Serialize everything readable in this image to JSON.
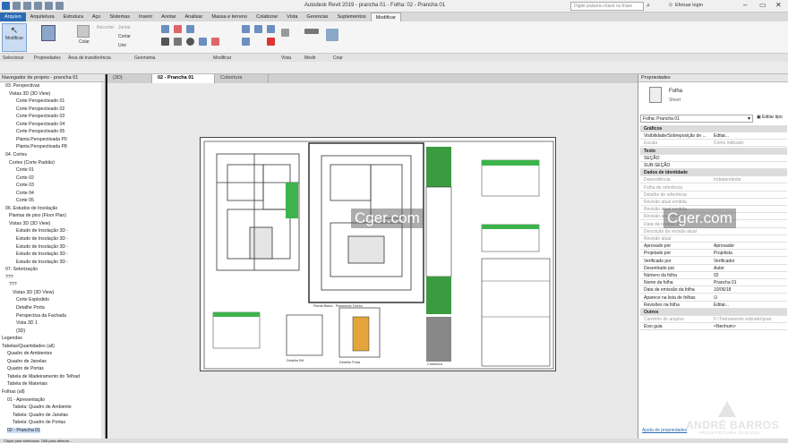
{
  "window": {
    "title": "Autodesk Revit 2019 - prancha 01 - Folha: 02 - Prancha 01",
    "search_placeholder": "Digite palavra-chave ou frase",
    "user": "Efetuar login"
  },
  "tabs": [
    "Arquivo",
    "Arquitetura",
    "Estrutura",
    "Aço",
    "Sistemas",
    "Inserir",
    "Anotar",
    "Analisar",
    "Massa e terreno",
    "Colaborar",
    "Vista",
    "Gerenciar",
    "Suplementos",
    "Modificar"
  ],
  "active_tab": "Modificar",
  "ribbon": {
    "modify_button": "Modificar",
    "buttons": [
      "Colar",
      "Recortar",
      "Cortar",
      "Unir",
      "Juntar"
    ],
    "panels": [
      "Selecionar",
      "Propriedades",
      "Área de transferência",
      "Geometria",
      "Modificar",
      "Vista",
      "Medir",
      "Criar"
    ]
  },
  "view_tabs": [
    "{3D}",
    "02 - Prancha 01",
    "Cobertura"
  ],
  "browser": {
    "title": "Navegador de projeto - prancha 01",
    "items": [
      "03. Perspectivas",
      "Vistas 3D (3D View)",
      "Corte Perspectivado 01",
      "Corte Perspectivado 02",
      "Corte Perspectivado 03",
      "Corte Perspectivado 04",
      "Corte Perspectivado 05",
      "Planta Perspectivada P0",
      "Planta Perspectivada P8",
      "04. Cortes",
      "Cortes (Corte Padrão)",
      "Corte 01",
      "Corte 02",
      "Corte 03",
      "Corte 04",
      "Corte 05",
      "06. Estudos de Insolação",
      "Plantas de piso (Floor Plan)",
      "Vistas 3D (3D View)",
      "Estudo de Insolação 3D -",
      "Estudo de Insolação 3D -",
      "Estudo de Insolação 3D -",
      "Estudo de Insolação 3D -",
      "Estudo de Insolação 3D -",
      "07. Setorização",
      "???",
      "???",
      "Vistas 3D (3D View)",
      "Corte Explodido",
      "Detalhe Porta",
      "Perspectiva da Fachada",
      "Vista 3D 1",
      "{3D}",
      "Legendas",
      "Tabelas/Quantidades (all)",
      "Quadro de Ambientes",
      "Quadro de Janelas",
      "Quadro de Portas",
      "Tabela de Madeiramento do Telhad",
      "Tabela de Materiais",
      "Folhas (all)",
      "01 - Apresentação",
      "Tabela: Quadro de Ambiente",
      "Tabela: Quadro de Janelas",
      "Tabela: Quadro de Portas",
      "02 - Prancha 01"
    ]
  },
  "sheet": {
    "labels": [
      "Planta Baixa - Pavimento Térreo",
      "Detalhe BH",
      "Detalhe Porta",
      "Cobertura"
    ],
    "watermark": "Cger.com"
  },
  "properties": {
    "title": "Propriedades",
    "type_name": "Folha",
    "type_sub": "Sheet",
    "selector": "Folha: Prancha 01",
    "edit_type": "Editar tipo",
    "rows": [
      {
        "k": "Gráficos",
        "v": "",
        "sec": true
      },
      {
        "k": "Visibilidade/Sobreposição de ...",
        "v": "Editar..."
      },
      {
        "k": "Escala",
        "v": "Como indicado",
        "dim": true
      },
      {
        "k": "Texto",
        "v": "",
        "sec": true
      },
      {
        "k": "SEÇÃO",
        "v": ""
      },
      {
        "k": "SUB-SEÇÃO",
        "v": ""
      },
      {
        "k": "Dados de identidade",
        "v": "",
        "sec": true
      },
      {
        "k": "Dependência",
        "v": "Independente",
        "dim": true
      },
      {
        "k": "Folha de referência",
        "v": "",
        "dim": true
      },
      {
        "k": "Detalhe de referência",
        "v": "",
        "dim": true
      },
      {
        "k": "Revisão atual emitida",
        "v": "",
        "dim": true
      },
      {
        "k": "Revisão atual emitida",
        "v": "",
        "dim": true
      },
      {
        "k": "Revisão atual emitida",
        "v": "",
        "dim": true
      },
      {
        "k": "Data da revisão atual",
        "v": "",
        "dim": true
      },
      {
        "k": "Descrição da revisão atual",
        "v": "",
        "dim": true
      },
      {
        "k": "Revisão atual",
        "v": "",
        "dim": true
      },
      {
        "k": "Aprovado por",
        "v": "Aprovador"
      },
      {
        "k": "Projetado por",
        "v": "Projetista"
      },
      {
        "k": "Verificado por",
        "v": "Verificador"
      },
      {
        "k": "Desenhado por",
        "v": "Autor"
      },
      {
        "k": "Número da folha",
        "v": "02"
      },
      {
        "k": "Nome da folha",
        "v": "Prancha 01"
      },
      {
        "k": "Data de emissão da folha",
        "v": "10/06/18"
      },
      {
        "k": "Aparece na lista de folhas",
        "v": "☑"
      },
      {
        "k": "Revisões na folha",
        "v": "Editar..."
      },
      {
        "k": "Outros",
        "v": "",
        "sec": true
      },
      {
        "k": "Caminho do arquivo",
        "v": "F:\\Treinamento sobrado\\pran",
        "dim": true
      },
      {
        "k": "Eixo guia",
        "v": "<Nenhum>"
      }
    ],
    "help_link": "Ajuda de propriedades",
    "watermark": "Cger.com"
  },
  "brand": {
    "name": "ANDRÉ BARROS",
    "sub": "ARQUITETURA DIGITAL"
  },
  "status": "Clique para selecionar, TAB para alternar..."
}
